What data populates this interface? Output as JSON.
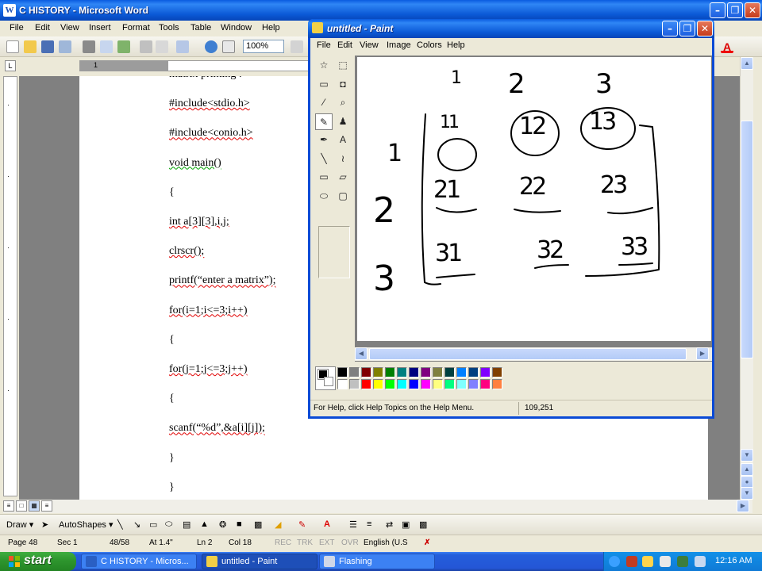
{
  "word": {
    "title": "C  HISTORY - Microsoft Word",
    "app_icon": "W",
    "menu": [
      "File",
      "Edit",
      "View",
      "Insert",
      "Format",
      "Tools",
      "Table",
      "Window",
      "Help"
    ],
    "zoom": "100%",
    "ruler_corner": "L",
    "ruler_number": "1",
    "code_lines": [
      "matrix printing :",
      "#include<stdio.h>",
      "#include<conio.h>",
      "void main()",
      "{",
      "int a[3][3],i,j;",
      "clrscr();",
      "printf(“enter a matrix”);",
      "for(i=1;i<=3;i++)",
      "{",
      "for(j=1;j<=3;j++)",
      "{",
      "scanf(“%d”,&a[i][j]);",
      "}",
      "}"
    ],
    "drawbar": {
      "draw": "Draw ▾",
      "autoshapes": "AutoShapes ▾"
    },
    "status": {
      "page": "Page 48",
      "sec": "Sec 1",
      "pages": "48/58",
      "at": "At 1.4\"",
      "ln": "Ln 2",
      "col": "Col 18",
      "rec": "REC",
      "trk": "TRK",
      "ext": "EXT",
      "ovr": "OVR",
      "lang": "English (U.S"
    }
  },
  "paint": {
    "title": "untitled - Paint",
    "menu": [
      "File",
      "Edit",
      "View",
      "Image",
      "Colors",
      "Help"
    ],
    "status_help": "For Help, click Help Topics on the Help Menu.",
    "coords": "109,251",
    "tools": [
      {
        "name": "free-form-select-tool-icon",
        "glyph": "☆"
      },
      {
        "name": "rect-select-tool-icon",
        "glyph": "⬚"
      },
      {
        "name": "eraser-tool-icon",
        "glyph": "▭"
      },
      {
        "name": "fill-tool-icon",
        "glyph": "◘"
      },
      {
        "name": "color-picker-tool-icon",
        "glyph": "⁄"
      },
      {
        "name": "magnifier-tool-icon",
        "glyph": "⌕"
      },
      {
        "name": "pencil-tool-icon",
        "glyph": "✎"
      },
      {
        "name": "brush-tool-icon",
        "glyph": "♟"
      },
      {
        "name": "airbrush-tool-icon",
        "glyph": "✒"
      },
      {
        "name": "text-tool-icon",
        "glyph": "A"
      },
      {
        "name": "line-tool-icon",
        "glyph": "╲"
      },
      {
        "name": "curve-tool-icon",
        "glyph": "≀"
      },
      {
        "name": "rectangle-tool-icon",
        "glyph": "▭"
      },
      {
        "name": "polygon-tool-icon",
        "glyph": "▱"
      },
      {
        "name": "ellipse-tool-icon",
        "glyph": "⬭"
      },
      {
        "name": "rounded-rect-tool-icon",
        "glyph": "▢"
      }
    ],
    "palette_row1": [
      "#000000",
      "#808080",
      "#800000",
      "#808000",
      "#008000",
      "#008080",
      "#000080",
      "#800080",
      "#808040",
      "#004040",
      "#0080ff",
      "#004080",
      "#8000ff",
      "#804000"
    ],
    "palette_row2": [
      "#ffffff",
      "#c0c0c0",
      "#ff0000",
      "#ffff00",
      "#00ff00",
      "#00ffff",
      "#0000ff",
      "#ff00ff",
      "#ffff80",
      "#00ff80",
      "#80ffff",
      "#8080ff",
      "#ff0080",
      "#ff8040"
    ],
    "handwriting": {
      "column_headers": [
        "1",
        "2",
        "3"
      ],
      "row_headers": [
        "1",
        "2",
        "3"
      ],
      "cells": [
        [
          "11",
          "12",
          "13"
        ],
        [
          "21",
          "22",
          "23"
        ],
        [
          "31",
          "32",
          "33"
        ]
      ]
    }
  },
  "taskbar": {
    "start": "start",
    "tasks": [
      {
        "label": "C  HISTORY - Micros...",
        "icon_color": "#2a5fc4"
      },
      {
        "label": "untitled - Paint",
        "icon_color": "#f2d046"
      },
      {
        "label": "Flashing",
        "icon_color": "#d0d8e8"
      }
    ],
    "clock": "12:16 AM"
  }
}
